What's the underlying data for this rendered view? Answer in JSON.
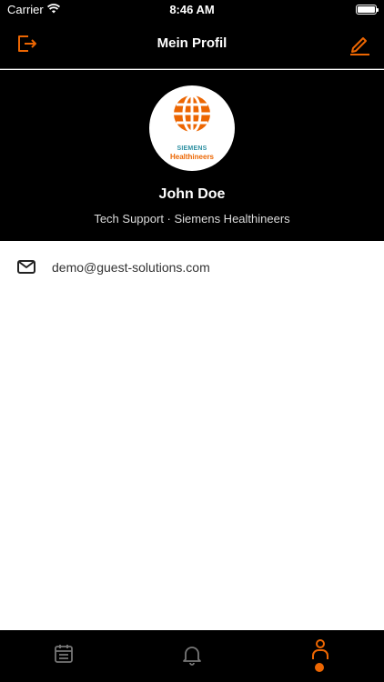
{
  "status_bar": {
    "carrier": "Carrier",
    "time": "8:46 AM"
  },
  "nav": {
    "title": "Mein Profil",
    "left_icon": "logout-icon",
    "right_icon": "edit-icon"
  },
  "profile": {
    "name": "John Doe",
    "subtitle": "Tech Support · Siemens Healthineers",
    "logo_line1": "SIEMENS",
    "logo_line2": "Healthineers"
  },
  "contact": {
    "email": "demo@guest-solutions.com",
    "email_icon": "mail-icon"
  },
  "tabs": [
    {
      "icon": "calendar-icon",
      "active": false
    },
    {
      "icon": "bell-icon",
      "active": false
    },
    {
      "icon": "person-icon",
      "active": true
    }
  ],
  "colors": {
    "accent": "#ec6602",
    "background_dark": "#000000",
    "logo_teal": "#2c8fa1"
  }
}
